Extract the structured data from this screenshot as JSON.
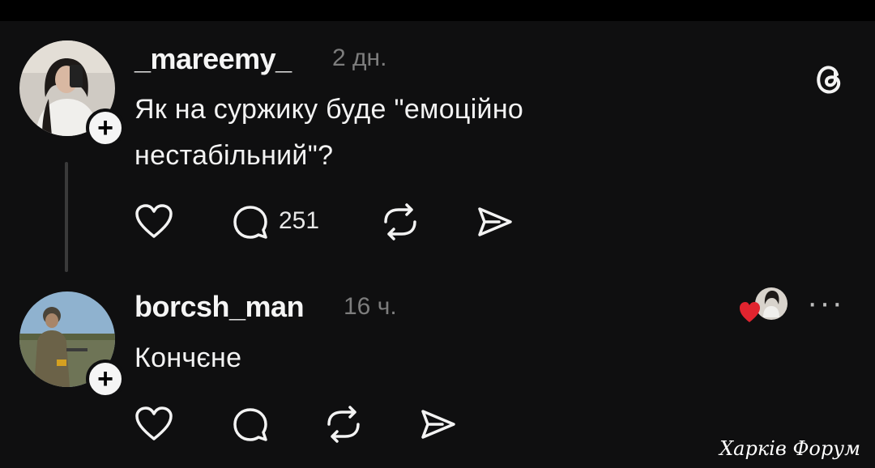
{
  "post": {
    "username": "_mareemy_",
    "time": "2 дн.",
    "text_line1": "Як на суржику буде \"емоційно",
    "text_line2": "нестабільний\"?",
    "reply_count": "251"
  },
  "reply": {
    "username": "borcsh_man",
    "time": "16 ч.",
    "text": "Кончєне"
  },
  "watermark": "Харків Форум",
  "colors": {
    "background": "#0f0f10",
    "muted_text": "#7d7d7d",
    "like_heart": "#e0242f"
  }
}
